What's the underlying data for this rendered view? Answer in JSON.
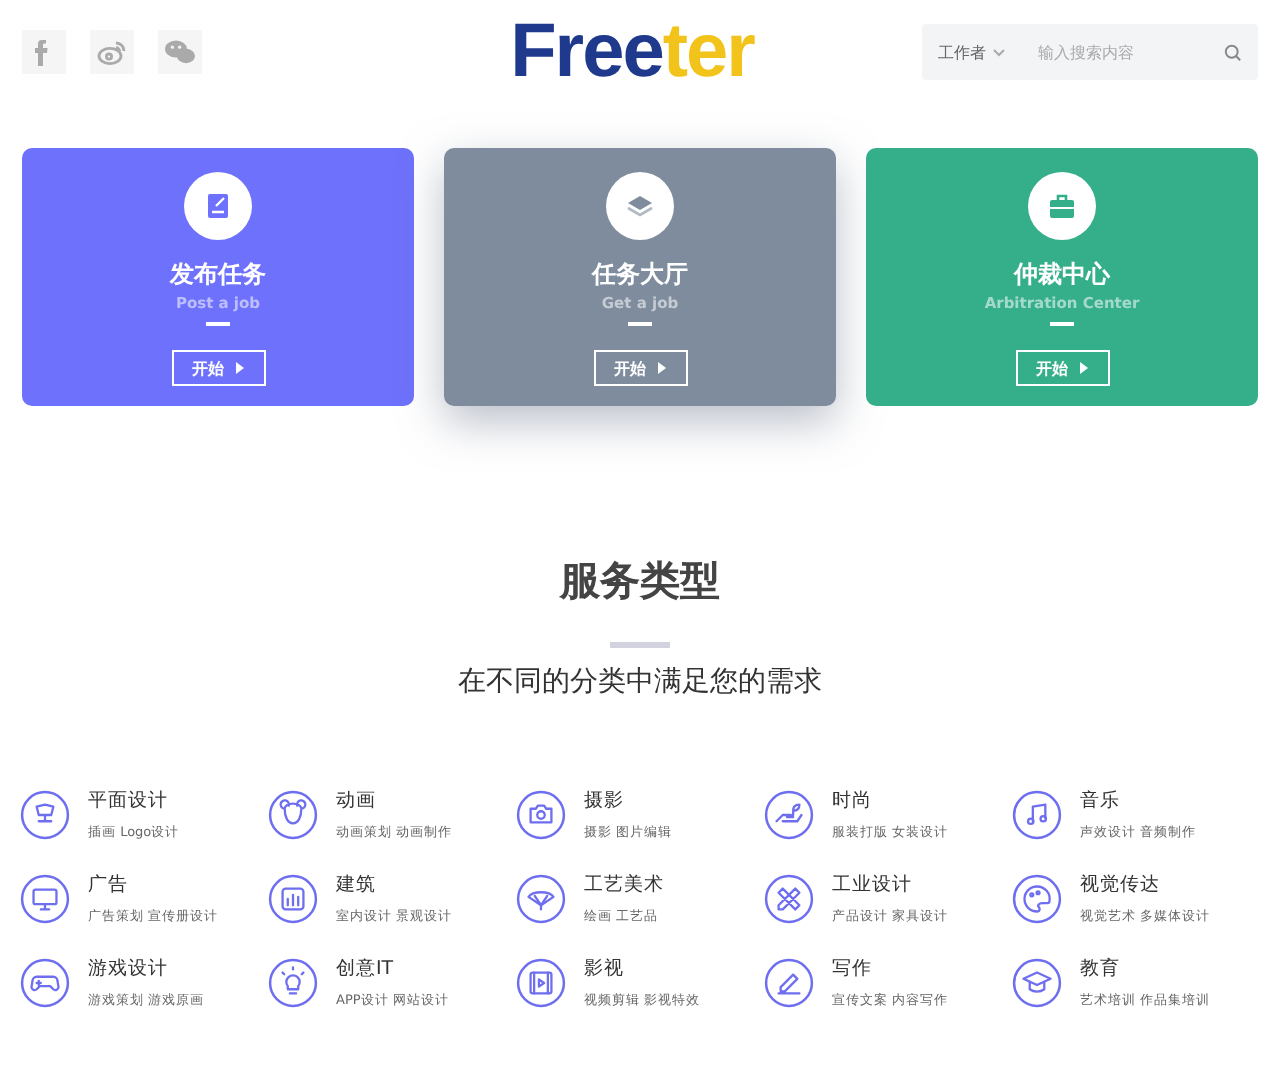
{
  "header": {
    "logo": [
      "Free",
      "ter"
    ],
    "search": {
      "category": "工作者",
      "placeholder": "输入搜索内容"
    }
  },
  "cards": [
    {
      "title": "发布任务",
      "subtitle": "Post a job",
      "button": "开始",
      "color": "#6e71fb",
      "raised": false
    },
    {
      "title": "任务大厅",
      "subtitle": "Get a job",
      "button": "开始",
      "color": "#7f8c9e",
      "raised": true
    },
    {
      "title": "仲裁中心",
      "subtitle": "Arbitration Center",
      "button": "开始",
      "color": "#35ae8a",
      "raised": false
    }
  ],
  "services": {
    "title": "服务类型",
    "subtitle": "在不同的分类中满足您的需求",
    "items": [
      {
        "title": "平面设计",
        "detail": "插画 Logo设计"
      },
      {
        "title": "动画",
        "detail": "动画策划 动画制作"
      },
      {
        "title": "摄影",
        "detail": "摄影 图片编辑"
      },
      {
        "title": "时尚",
        "detail": "服装打版 女装设计"
      },
      {
        "title": "音乐",
        "detail": "声效设计 音频制作"
      },
      {
        "title": "广告",
        "detail": "广告策划 宣传册设计"
      },
      {
        "title": "建筑",
        "detail": "室内设计 景观设计"
      },
      {
        "title": "工艺美术",
        "detail": "绘画 工艺品"
      },
      {
        "title": "工业设计",
        "detail": "产品设计 家具设计"
      },
      {
        "title": "视觉传达",
        "detail": "视觉艺术 多媒体设计"
      },
      {
        "title": "游戏设计",
        "detail": "游戏策划 游戏原画"
      },
      {
        "title": "创意IT",
        "detail": "APP设计 网站设计"
      },
      {
        "title": "影视",
        "detail": "视频剪辑 影视特效"
      },
      {
        "title": "写作",
        "detail": "宣传文案 内容写作"
      },
      {
        "title": "教育",
        "detail": "艺术培训 作品集培训"
      }
    ]
  }
}
